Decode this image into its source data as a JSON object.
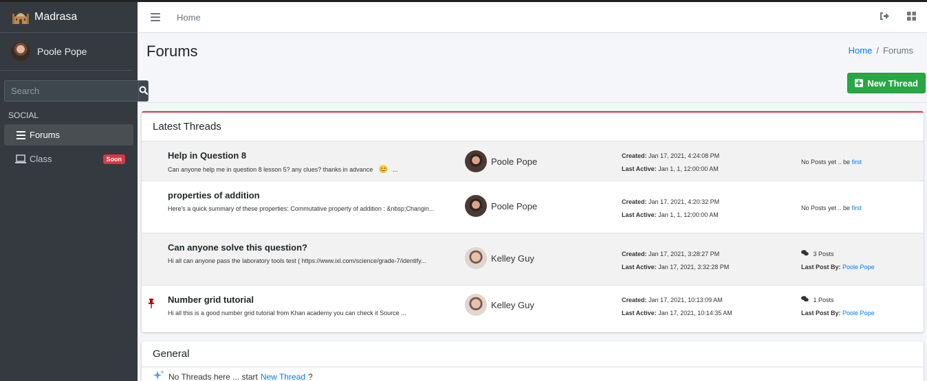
{
  "app": {
    "brand": "Madrasa"
  },
  "user": {
    "name": "Poole Pope"
  },
  "sidebar": {
    "search_placeholder": "Search",
    "section_header": "SOCIAL",
    "items": [
      {
        "label": "Forums",
        "icon": "list-icon",
        "active": true
      },
      {
        "label": "Class",
        "icon": "laptop-icon",
        "badge": "Soon"
      }
    ]
  },
  "topbar": {
    "home_link": "Home"
  },
  "page": {
    "title": "Forums",
    "breadcrumb": {
      "home": "Home",
      "separator": "/",
      "current": "Forums"
    },
    "new_thread_label": "New Thread"
  },
  "latest": {
    "title": "Latest Threads",
    "threads": [
      {
        "title": "Help in Question 8",
        "excerpt": "Can anyone help me in question 8 lesson 5? any clues? thanks in advance",
        "excerpt_emoji": "😊",
        "excerpt_tail": "...",
        "author": "Poole Pope",
        "created_label": "Created:",
        "created": "Jan 17, 2021, 4:24:08 PM",
        "active_label": "Last Active:",
        "active": "Jan 1, 1, 12:00:00 AM",
        "posts_text": "No Posts yet .. be",
        "posts_link": "first"
      },
      {
        "title": "properties of addition",
        "excerpt": "Here's a quick summary of these properties: Commutative property of addition : &nbsp;Changin...",
        "author": "Poole Pope",
        "created_label": "Created:",
        "created": "Jan 17, 2021, 4:20:32 PM",
        "active_label": "Last Active:",
        "active": "Jan 1, 1, 12:00:00 AM",
        "posts_text": "No Posts yet .. be",
        "posts_link": "first"
      },
      {
        "title": "Can anyone solve this question?",
        "excerpt": "Hi all can anyone pass the laboratory tools test ( https://www.ixl.com/science/grade-7/identify...",
        "author": "Kelley Guy",
        "created_label": "Created:",
        "created": "Jan 17, 2021, 3:28:27 PM",
        "active_label": "Last Active:",
        "active": "Jan 17, 2021, 3:32:28 PM",
        "post_count": "3 Posts",
        "last_post_label": "Last Post By:",
        "last_post_by": "Poole Pope"
      },
      {
        "title": "Number grid tutorial",
        "excerpt": "Hi all this is a good number grid tutorial from Khan academy you can check it Source ...",
        "author": "Kelley Guy",
        "created_label": "Created:",
        "created": "Jan 17, 2021, 10:13:09 AM",
        "active_label": "Last Active:",
        "active": "Jan 17, 2021, 10:14:35 AM",
        "post_count": "1 Posts",
        "last_post_label": "Last Post By:",
        "last_post_by": "Poole Pope",
        "pinned": true
      }
    ]
  },
  "general": {
    "title": "General",
    "empty_text": "No Threads here ... start",
    "empty_link": "New Thread",
    "empty_tail": "?"
  }
}
